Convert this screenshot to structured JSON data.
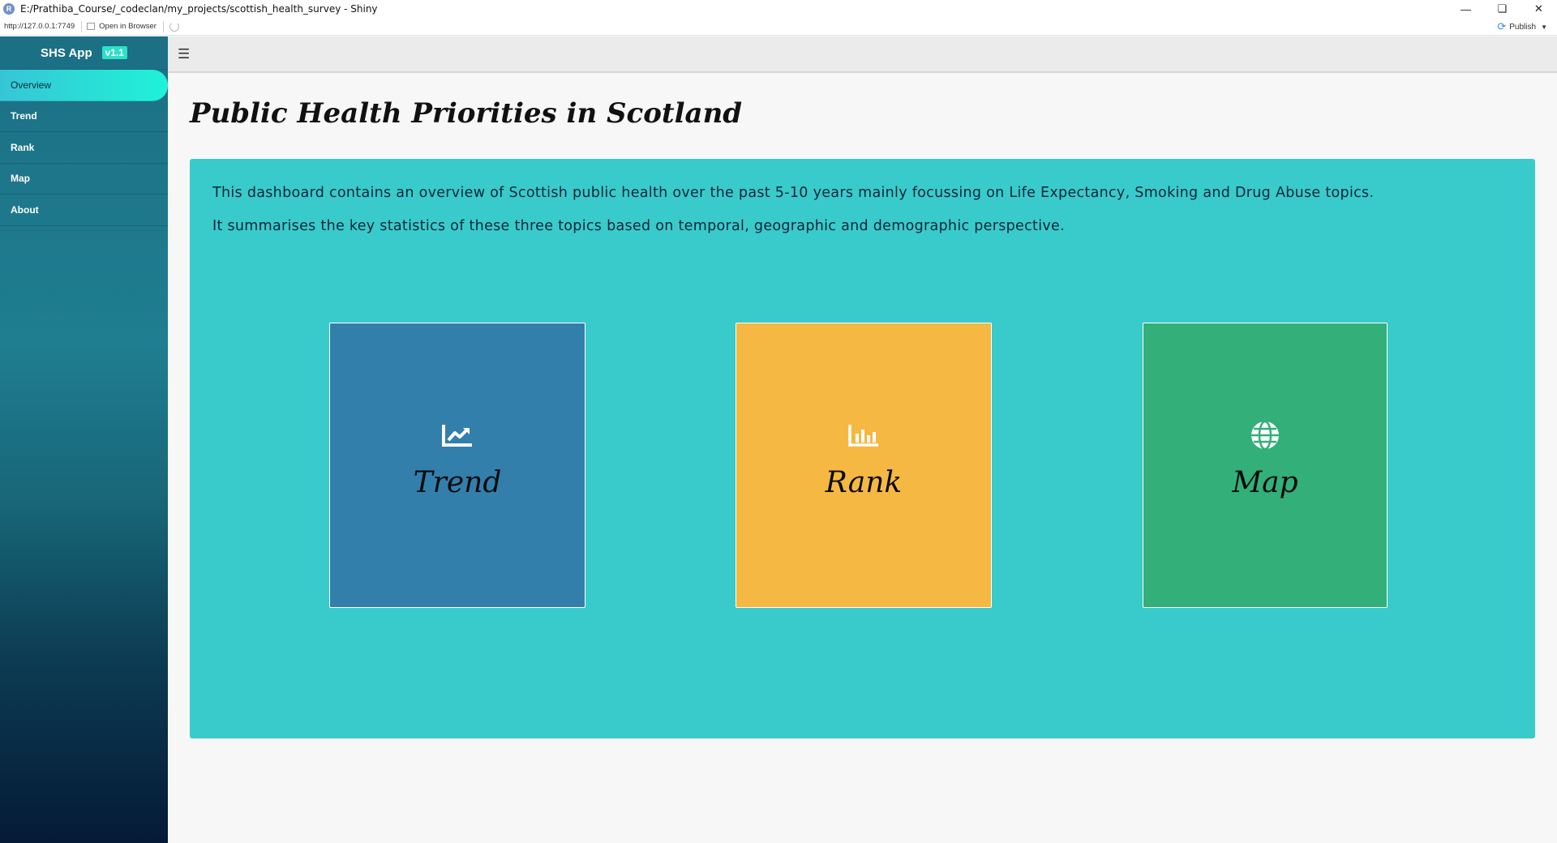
{
  "window": {
    "title": "E:/Prathiba_Course/_codeclan/my_projects/scottish_health_survey - Shiny",
    "app_icon": "R",
    "controls": [
      "minimize-icon",
      "restore-icon",
      "close-icon"
    ]
  },
  "viewer": {
    "url": "http://127.0.0.1:7749",
    "open_browser": "Open in Browser",
    "publish": "Publish"
  },
  "sidebar": {
    "brand": "SHS App",
    "version": "v1.1",
    "items": [
      {
        "label": "Overview",
        "active": true
      },
      {
        "label": "Trend",
        "active": false
      },
      {
        "label": "Rank",
        "active": false
      },
      {
        "label": "Map",
        "active": false
      },
      {
        "label": "About",
        "active": false
      }
    ]
  },
  "header": {
    "menu_icon": "hamburger-icon"
  },
  "main": {
    "title": "Public Health Priorities in Scotland",
    "intro": [
      "This dashboard contains an overview of Scottish public health over the past 5-10 years mainly focussing on Life Expectancy, Smoking and Drug Abuse topics.",
      "It summarises the key statistics of these three topics based on temporal, geographic and demographic perspective."
    ],
    "cards": [
      {
        "label": "Trend",
        "icon": "line-chart-icon",
        "color": "#337fac"
      },
      {
        "label": "Rank",
        "icon": "bar-chart-icon",
        "color": "#f5b842"
      },
      {
        "label": "Map",
        "icon": "globe-icon",
        "color": "#33af7a"
      }
    ]
  },
  "colors": {
    "panel": "#39cbcb",
    "active_tab": "#1ff2d7",
    "version_badge": "#2de0c8"
  }
}
